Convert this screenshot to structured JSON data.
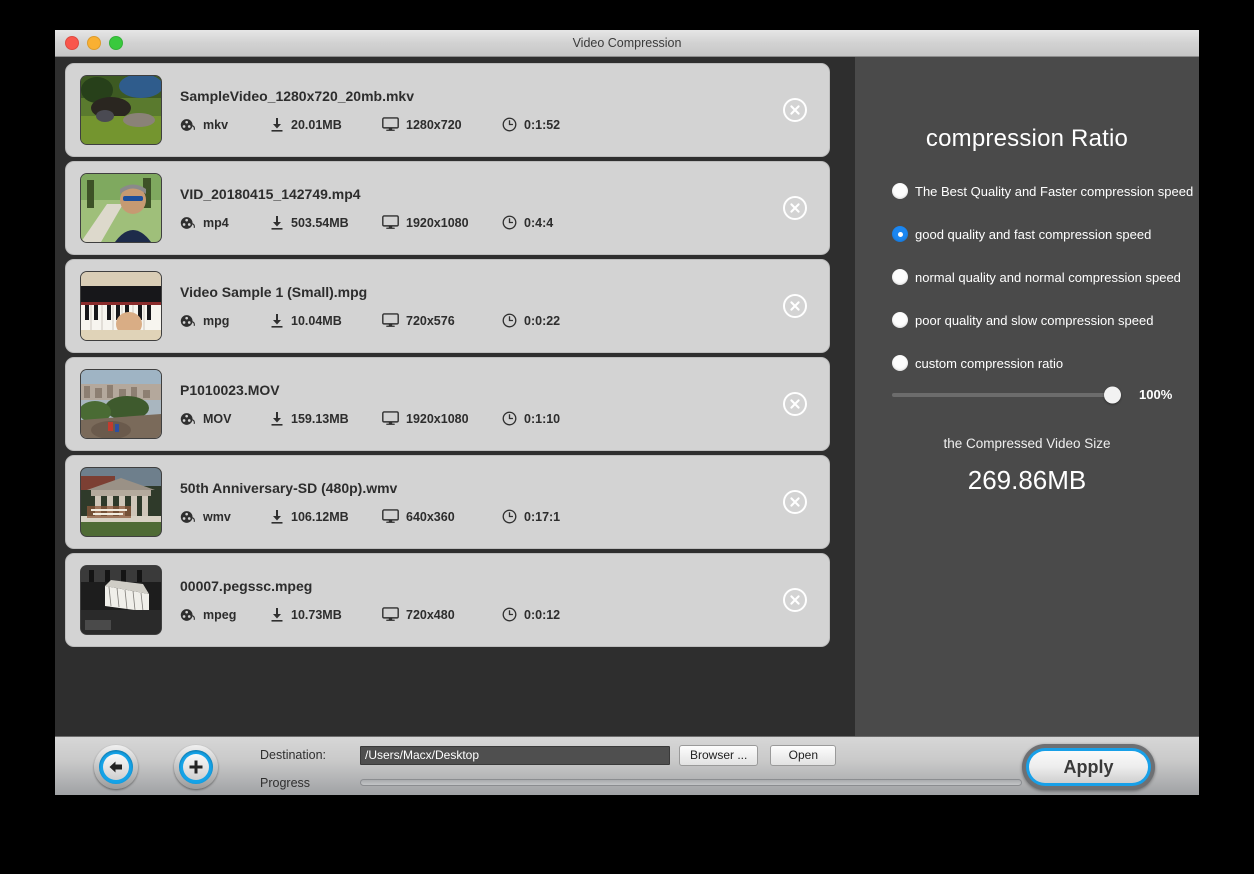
{
  "window": {
    "title": "Video Compression",
    "traffic_lights": [
      "close-button",
      "minimize-button",
      "maximize-button"
    ]
  },
  "videos": [
    {
      "filename": "SampleVideo_1280x720_20mb.mkv",
      "format": "mkv",
      "size": "20.01MB",
      "resolution": "1280x720",
      "duration": "0:1:52",
      "thumb": "forest-mossy-rocks"
    },
    {
      "filename": "VID_20180415_142749.mp4",
      "format": "mp4",
      "size": "503.54MB",
      "resolution": "1920x1080",
      "duration": "0:4:4",
      "thumb": "man-sunglasses-park"
    },
    {
      "filename": "Video Sample 1 (Small).mpg",
      "format": "mpg",
      "size": "10.04MB",
      "resolution": "720x576",
      "duration": "0:0:22",
      "thumb": "piano-keyboard-hands"
    },
    {
      "filename": "P1010023.MOV",
      "format": "MOV",
      "size": "159.13MB",
      "resolution": "1920x1080",
      "duration": "0:1:10",
      "thumb": "hillside-city-overlook"
    },
    {
      "filename": "50th Anniversary-SD (480p).wmv",
      "format": "wmv",
      "size": "106.12MB",
      "resolution": "640x360",
      "duration": "0:17:1",
      "thumb": "columned-building-lawn"
    },
    {
      "filename": "00007.pegssc.mpeg",
      "format": "mpeg",
      "size": "10.73MB",
      "resolution": "720x480",
      "duration": "0:0:12",
      "thumb": "bw-industrial-structure"
    }
  ],
  "icons": {
    "format": "film-reel-icon",
    "size": "download-icon",
    "resolution": "monitor-icon",
    "duration": "clock-icon",
    "remove": "remove-circle-icon",
    "back": "back-arrow-icon",
    "add": "plus-icon"
  },
  "panel": {
    "title": "compression Ratio",
    "options": [
      {
        "label": "The Best Quality and Faster compression speed",
        "selected": false
      },
      {
        "label": "good quality and fast compression speed",
        "selected": true
      },
      {
        "label": "normal quality and normal compression speed",
        "selected": false
      },
      {
        "label": "poor quality and slow compression speed",
        "selected": false
      },
      {
        "label": "custom compression ratio",
        "selected": false
      }
    ],
    "slider": {
      "value": "100%",
      "percent": 100
    },
    "compressed_label": "the Compressed Video Size",
    "compressed_value": "269.86MB"
  },
  "bottom": {
    "destination_label": "Destination:",
    "destination_value": "/Users/Macx/Desktop",
    "destination_placeholder": "/Users/Macx/Desktop",
    "browser_label": "Browser ...",
    "open_label": "Open",
    "progress_label": "Progress",
    "progress_percent": 0,
    "apply_label": "Apply"
  },
  "colors": {
    "accent_blue": "#18a0e8",
    "radio_selected": "#1b87f2",
    "panel_bg": "#4a4a4a",
    "list_bg": "#2e2e2e",
    "row_bg": "#d3d3d3"
  }
}
